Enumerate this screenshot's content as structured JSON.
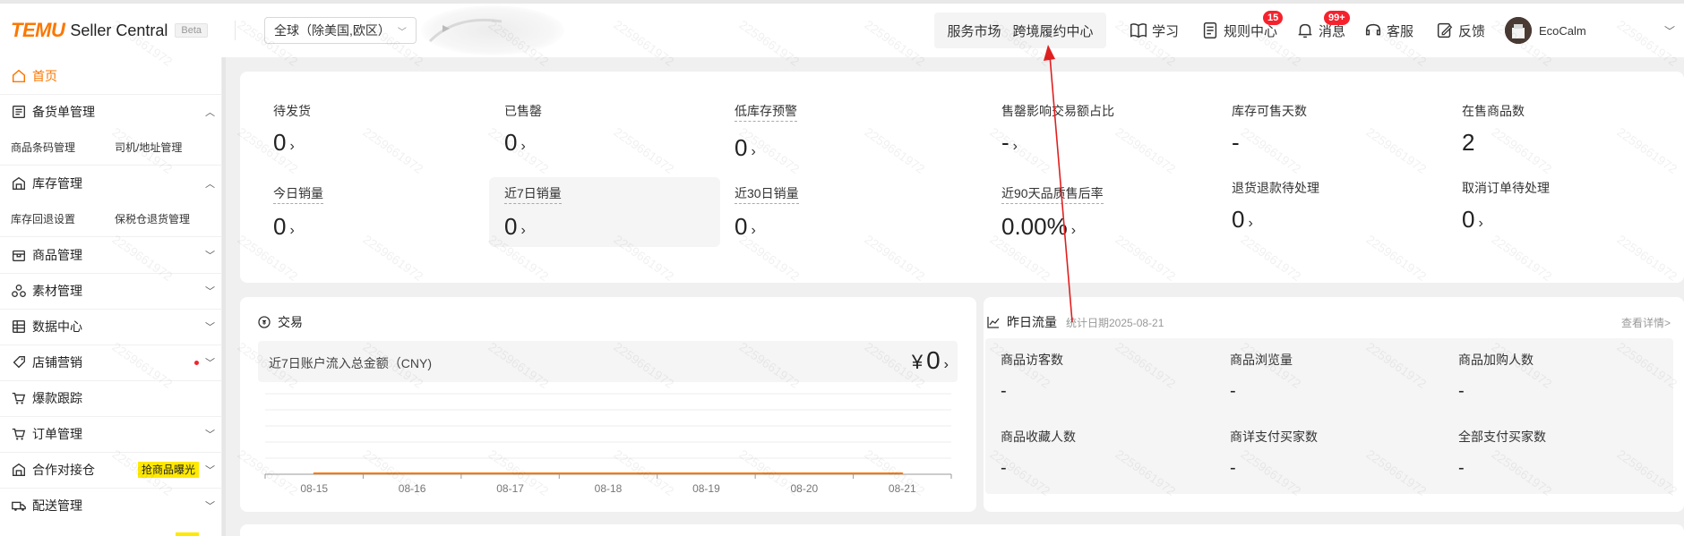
{
  "header": {
    "logo_brand": "TEMU",
    "logo_product": "Seller Central",
    "beta": "Beta",
    "region": "全球（除美国,欧区）",
    "service_market": "服务市场",
    "cross_border": "跨境履约中心",
    "learn": "学习",
    "rules": "规则中心",
    "rules_badge": "15",
    "messages": "消息",
    "messages_badge": "99+",
    "support": "客服",
    "feedback": "反馈",
    "username": "EcoCalm"
  },
  "sidebar": {
    "home": "首页",
    "stock_order": "备货单管理",
    "sub_barcode": "商品条码管理",
    "sub_driver": "司机/地址管理",
    "inventory": "库存管理",
    "sub_return_setting": "库存回退设置",
    "sub_bonded": "保税仓退货管理",
    "products": "商品管理",
    "materials": "素材管理",
    "data_center": "数据中心",
    "marketing": "店铺营销",
    "hot_tracking": "爆款跟踪",
    "orders": "订单管理",
    "cooperation": "合作对接仓",
    "cooperation_tag": "抢商品曝光",
    "delivery": "配送管理"
  },
  "stats": [
    {
      "label": "待发货",
      "value": "0"
    },
    {
      "label": "已售罄",
      "value": "0"
    },
    {
      "label": "低库存预警",
      "value": "0"
    },
    {
      "label": "售罄影响交易额占比",
      "value": "-"
    },
    {
      "label": "库存可售天数",
      "value": "-"
    },
    {
      "label": "在售商品数",
      "value": "2"
    },
    {
      "label": "今日销量",
      "value": "0"
    },
    {
      "label": "近7日销量",
      "value": "0"
    },
    {
      "label": "近30日销量",
      "value": "0"
    },
    {
      "label": "近90天品质售后率",
      "value": "0.00%"
    },
    {
      "label": "退货退款待处理",
      "value": "0"
    },
    {
      "label": "取消订单待处理",
      "value": "0"
    }
  ],
  "transaction": {
    "title": "交易",
    "amount_label": "近7日账户流入总金额（CNY)",
    "currency": "¥",
    "amount": "0"
  },
  "chart_data": {
    "type": "line",
    "categories": [
      "08-15",
      "08-16",
      "08-17",
      "08-18",
      "08-19",
      "08-20",
      "08-21"
    ],
    "series": [
      {
        "values": [
          0,
          0,
          0,
          0,
          0,
          0,
          0
        ],
        "color": "#fb7701"
      }
    ],
    "xlabel": "",
    "ylabel": "",
    "grid": true
  },
  "traffic": {
    "title": "昨日流量",
    "date_label": "统计日期2025-08-21",
    "details_link": "查看详情>",
    "metrics": [
      {
        "label": "商品访客数",
        "value": "-"
      },
      {
        "label": "商品浏览量",
        "value": "-"
      },
      {
        "label": "商品加购人数",
        "value": "-"
      },
      {
        "label": "商品收藏人数",
        "value": "-"
      },
      {
        "label": "商详支付买家数",
        "value": "-"
      },
      {
        "label": "全部支付买家数",
        "value": "-"
      }
    ]
  },
  "watermark": "2259661972",
  "colors": {
    "brand": "#fb7701",
    "badge": "#f5222d",
    "annotation": "#e02020"
  }
}
